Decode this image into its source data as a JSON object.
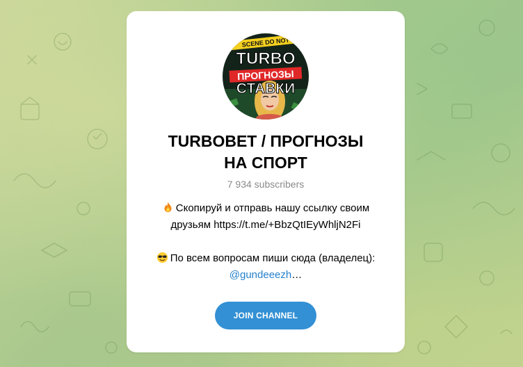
{
  "channel": {
    "avatar": {
      "top_text": "TURBO",
      "middle_text": "ПРОГНОЗЫ",
      "bottom_text": "СТАВКИ",
      "tape_text": "SCENE DO NOT"
    },
    "title_line1": "TURBOBET / ПРОГНОЗЫ",
    "title_line2": "НА СПОРТ",
    "subscribers": "7 934 subscribers",
    "description": {
      "line1_emoji": "fire-icon",
      "line1": "Скопируй и отправь нашу ссылку своим",
      "line2": "друзьям https://t.me/+BbzQtIEyWhljN2Fi",
      "line3_emoji": "sunglasses-face-icon",
      "line3": "По всем вопросам пиши сюда (владелец):",
      "mention": "@gundeeezh",
      "mention_suffix": "…"
    },
    "join_button": "JOIN CHANNEL"
  },
  "colors": {
    "accent": "#3390d4",
    "link": "#2481cc",
    "muted": "#8a8a8a",
    "card": "#ffffff"
  }
}
